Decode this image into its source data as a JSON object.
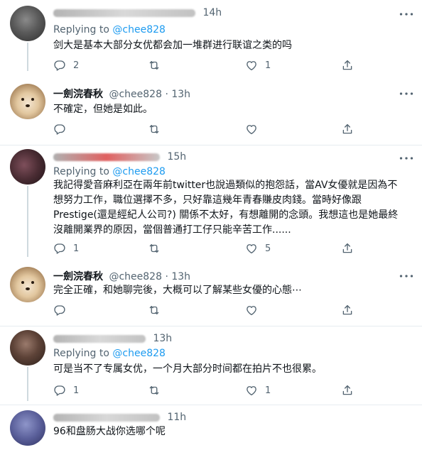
{
  "tweets": [
    {
      "author_visible": false,
      "time": "14h",
      "replying_prefix": "Replying to",
      "replying_to": "@chee828",
      "text": "剑大是基本大部分女优都会加一堆群进行联谊之类的吗",
      "reply_count": "2",
      "retweet_count": "",
      "like_count": "1"
    },
    {
      "author_visible": true,
      "name": "一劍浣春秋",
      "handle": "@chee828",
      "dot": "·",
      "time": "13h",
      "text": "不確定，但她是如此。",
      "reply_count": "",
      "retweet_count": "",
      "like_count": ""
    },
    {
      "author_visible": false,
      "time": "15h",
      "replying_prefix": "Replying to",
      "replying_to": "@chee828",
      "text_lines": [
        "我記得愛音麻利亞在兩年前twitter也說過類似的抱怨話，當AV女優就是因為不",
        "想努力工作，職位選擇不多，只好靠這幾年青春賺皮肉錢。當時好像跟",
        "Prestige(還是經紀人公司?) 關係不太好，有想離開的念頭。我想這也是她最終",
        "沒離開業界的原因，當個普通打工仔只能辛苦工作......"
      ],
      "reply_count": "1",
      "retweet_count": "",
      "like_count": "5"
    },
    {
      "author_visible": true,
      "name": "一劍浣春秋",
      "handle": "@chee828",
      "dot": "·",
      "time": "13h",
      "text": "完全正確，和她聊完後，大概可以了解某些女優的心態⋯",
      "reply_count": "",
      "retweet_count": "",
      "like_count": ""
    },
    {
      "author_visible": false,
      "time": "13h",
      "replying_prefix": "Replying to",
      "replying_to": "@chee828",
      "text": "可是当不了专属女优，一个月大部分时间都在拍片不也很累。",
      "reply_count": "1",
      "retweet_count": "",
      "like_count": "1"
    },
    {
      "author_visible": false,
      "time": "11h",
      "text": "96和盘肠大战你选哪个呢"
    }
  ],
  "colors": {
    "text": "#0f1419",
    "secondary": "#536471",
    "accent": "#1d9bf0",
    "separator": "#e6ecf0"
  },
  "icons": [
    "reply-icon",
    "retweet-icon",
    "like-icon",
    "share-icon",
    "more-icon"
  ]
}
